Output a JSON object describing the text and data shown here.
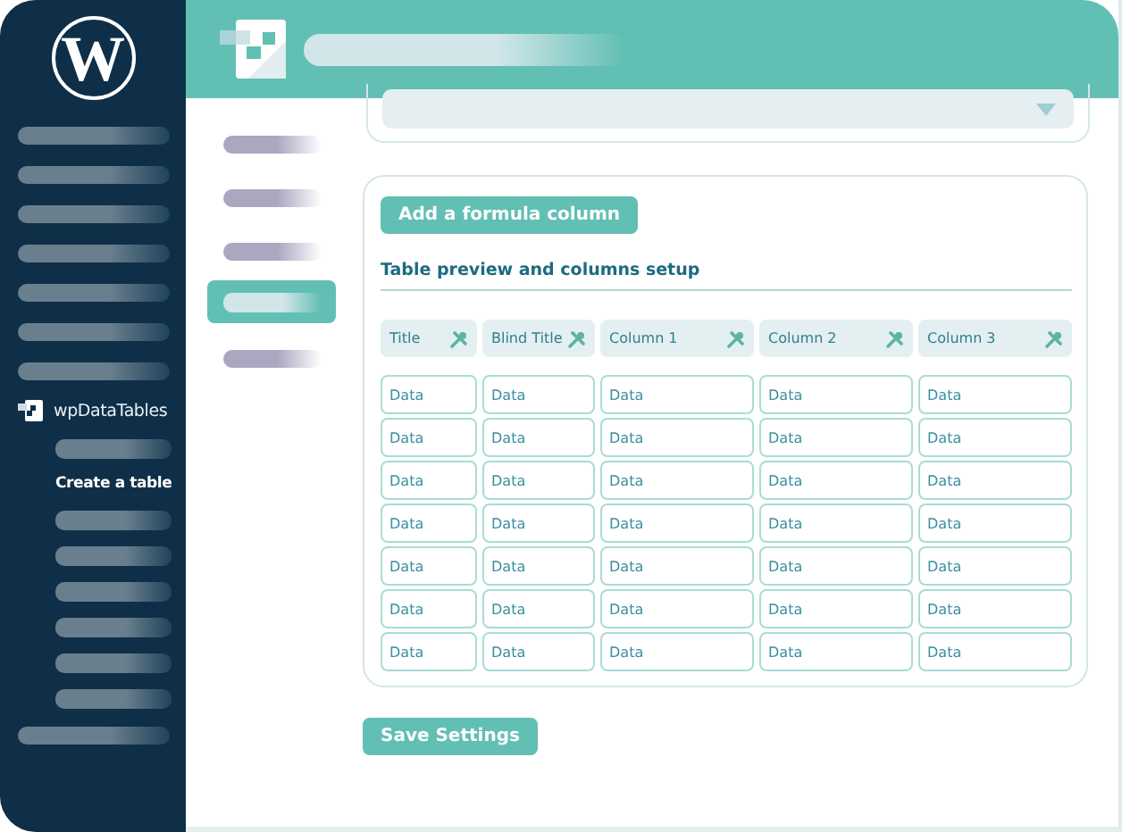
{
  "sidebar": {
    "logo_letter": "W",
    "items": [
      {
        "kind": "placeholder"
      },
      {
        "kind": "placeholder"
      },
      {
        "kind": "placeholder"
      },
      {
        "kind": "placeholder"
      },
      {
        "kind": "placeholder"
      },
      {
        "kind": "placeholder"
      },
      {
        "kind": "placeholder"
      },
      {
        "kind": "plugin",
        "label": "wpDataTables",
        "children": [
          {
            "kind": "placeholder"
          },
          {
            "kind": "current",
            "label": "Create a table"
          },
          {
            "kind": "placeholder"
          },
          {
            "kind": "placeholder"
          },
          {
            "kind": "placeholder"
          },
          {
            "kind": "placeholder"
          },
          {
            "kind": "placeholder"
          },
          {
            "kind": "placeholder"
          }
        ]
      },
      {
        "kind": "placeholder"
      }
    ]
  },
  "tabs": [
    {
      "selected": false
    },
    {
      "selected": false
    },
    {
      "selected": false
    },
    {
      "selected": true
    },
    {
      "selected": false
    }
  ],
  "columns_card": {
    "button": "Add a formula column",
    "heading": "Table preview and columns setup",
    "columns": [
      "Title",
      "Blind Title",
      "Column 1",
      "Column 2",
      "Column 3"
    ],
    "rows": [
      [
        "Data",
        "Data",
        "Data",
        "Data",
        "Data"
      ],
      [
        "Data",
        "Data",
        "Data",
        "Data",
        "Data"
      ],
      [
        "Data",
        "Data",
        "Data",
        "Data",
        "Data"
      ],
      [
        "Data",
        "Data",
        "Data",
        "Data",
        "Data"
      ],
      [
        "Data",
        "Data",
        "Data",
        "Data",
        "Data"
      ],
      [
        "Data",
        "Data",
        "Data",
        "Data",
        "Data"
      ],
      [
        "Data",
        "Data",
        "Data",
        "Data",
        "Data"
      ]
    ]
  },
  "save_button": "Save Settings"
}
